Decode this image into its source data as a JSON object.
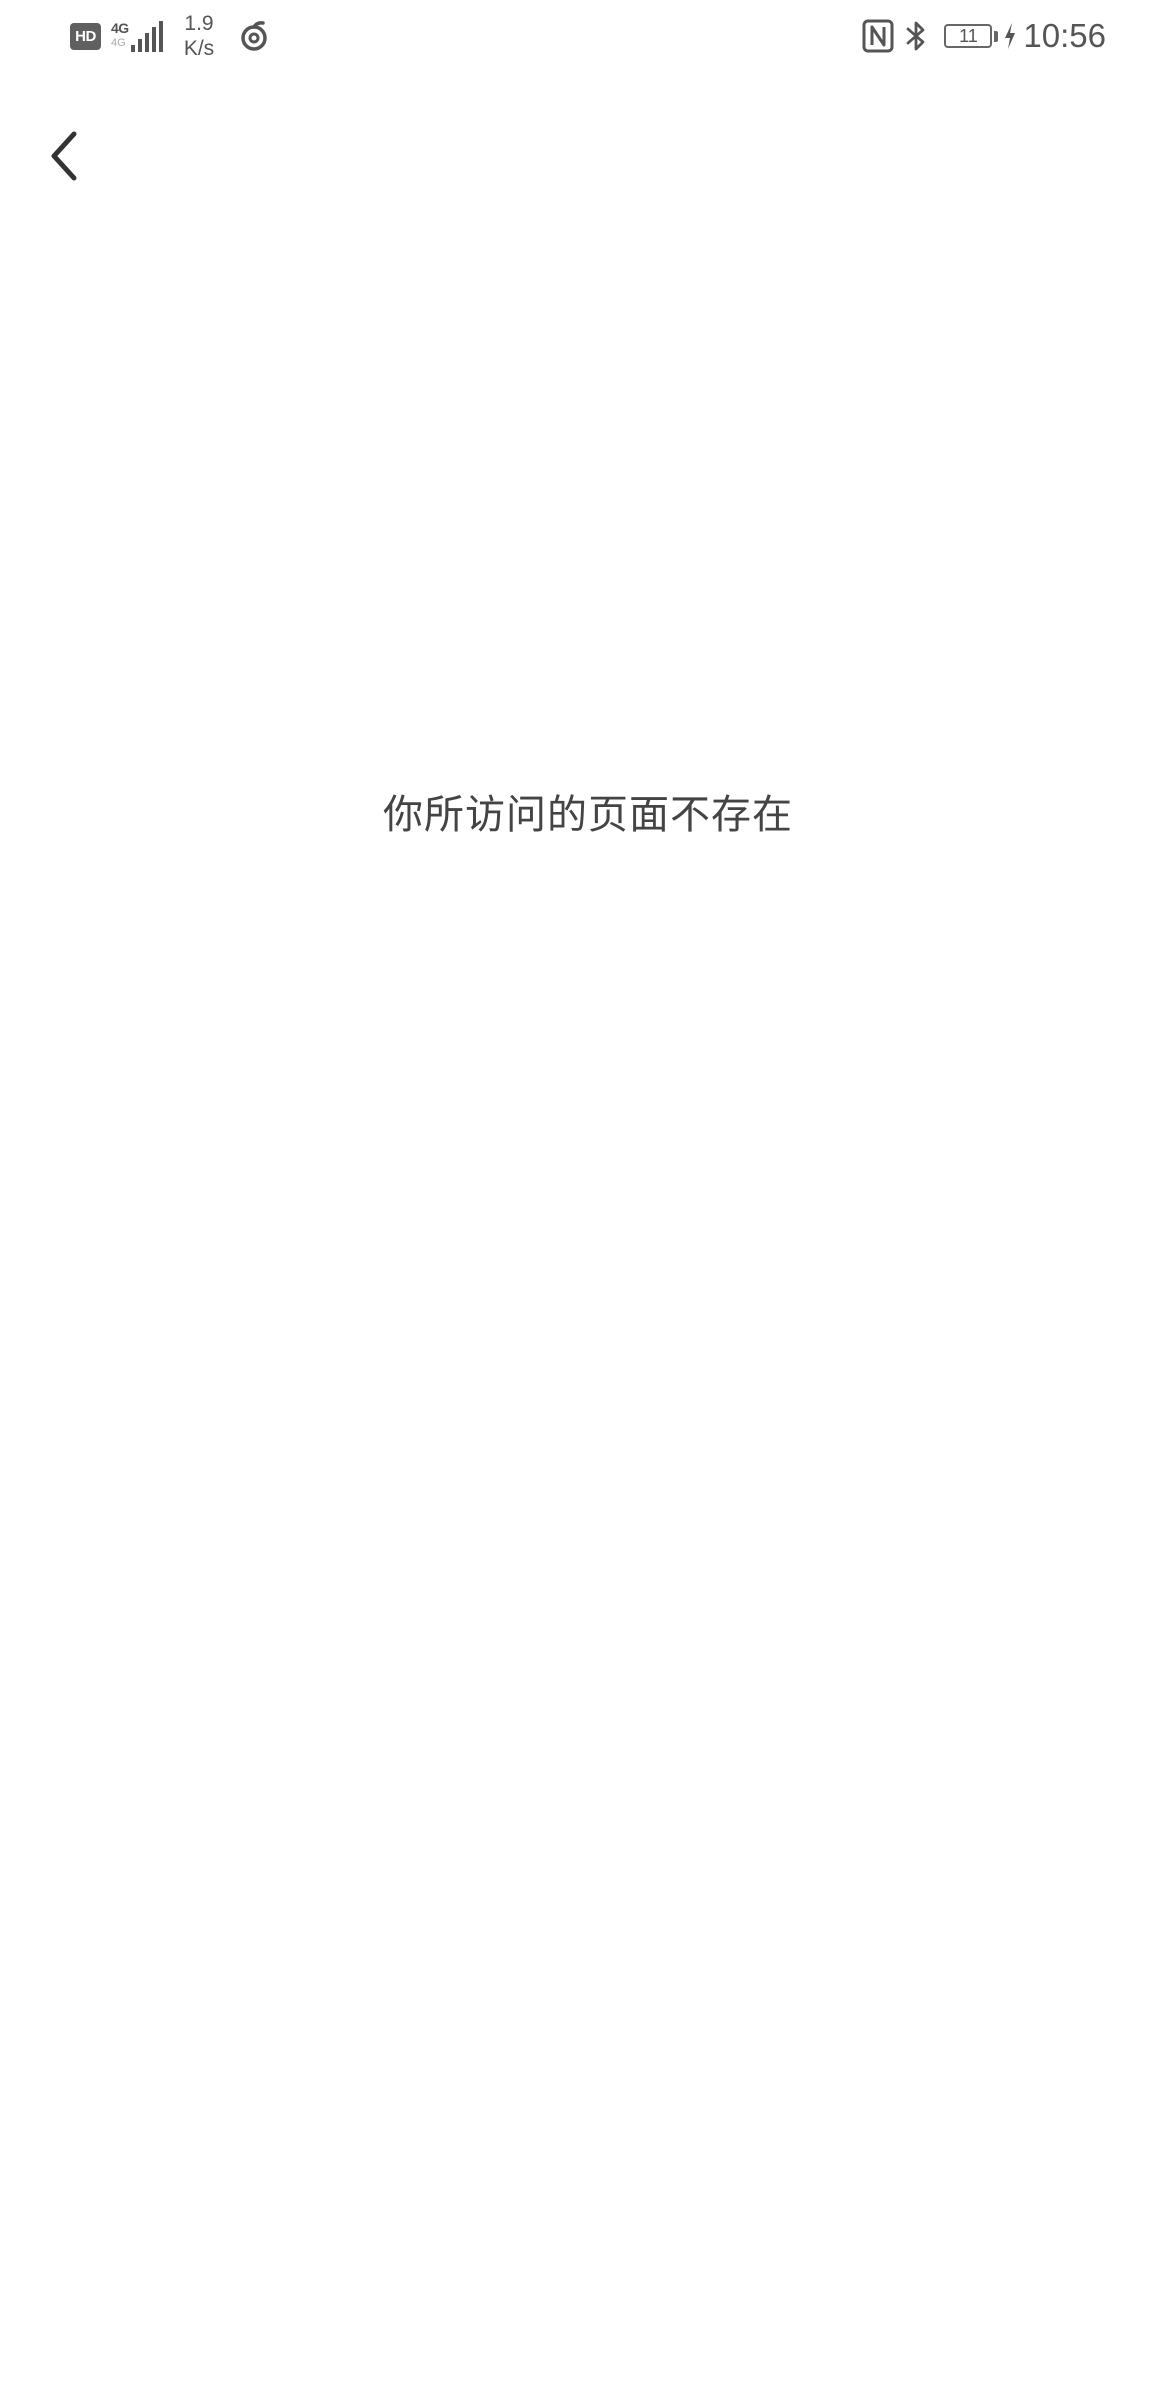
{
  "status_bar": {
    "hd_badge": "HD",
    "network_type": "4G",
    "network_type_secondary": "4G",
    "speed_value": "1.9",
    "speed_unit": "K/s",
    "battery_level": "11",
    "time": "10:56",
    "icons": [
      "hd-icon",
      "signal-icon",
      "app-notification-icon",
      "nfc-icon",
      "bluetooth-icon",
      "battery-icon",
      "charging-icon"
    ]
  },
  "header": {
    "back_icon": "chevron-left-icon"
  },
  "main": {
    "message": "你所访问的页面不存在"
  },
  "colors": {
    "background": "#ffffff",
    "text": "#444444",
    "icon": "#555555"
  }
}
